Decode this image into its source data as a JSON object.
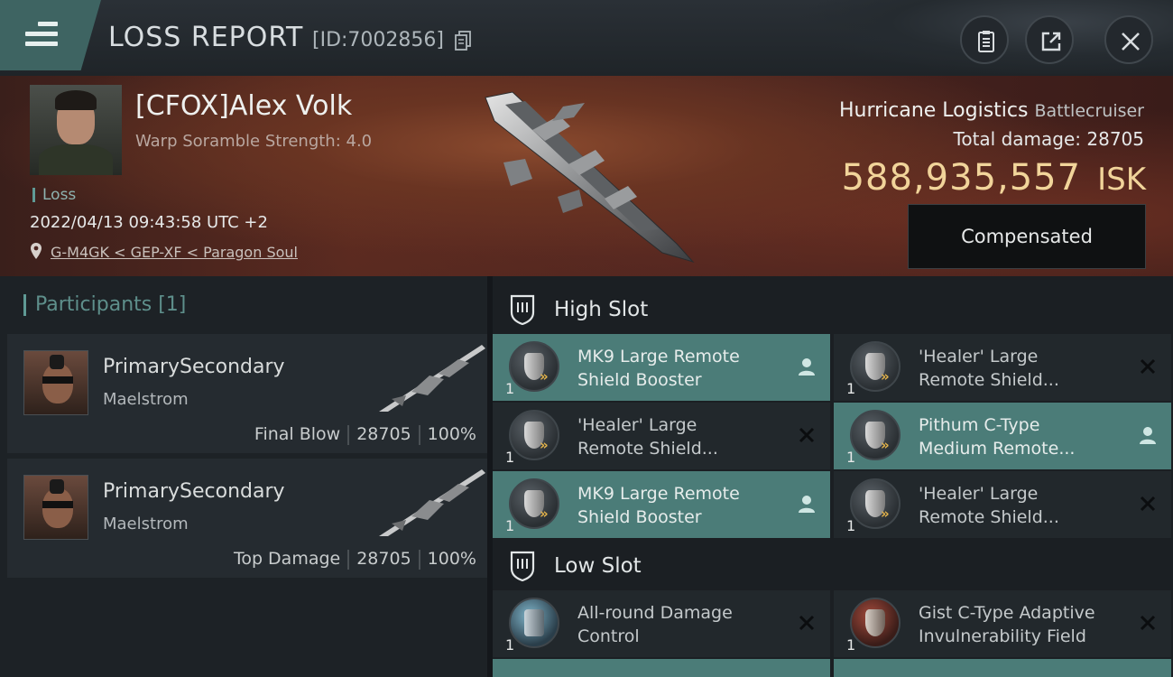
{
  "header": {
    "title": "LOSS REPORT",
    "report_id": "[ID:7002856]"
  },
  "victim": {
    "name": "[CFOX]Alex Volk",
    "scramble": "Warp Soramble Strength: 4.0",
    "tag": "Loss",
    "time": "2022/04/13 09:43:58 UTC +2",
    "location": "G-M4GK < GEP-XF < Paragon Soul",
    "ship_name": "Hurricane Logistics",
    "ship_class": "Battlecruiser",
    "damage_label": "Total damage:",
    "damage_value": "28705",
    "isk_value": "588,935,557",
    "isk_unit": "ISK",
    "compensated_label": "Compensated"
  },
  "participants": {
    "heading": "Participants [1]",
    "items": [
      {
        "name": "PrimarySecondary",
        "ship": "Maelstrom",
        "role": "Final Blow",
        "damage": "28705",
        "percent": "100%"
      },
      {
        "name": "PrimarySecondary",
        "ship": "Maelstrom",
        "role": "Top Damage",
        "damage": "28705",
        "percent": "100%"
      }
    ]
  },
  "slots": {
    "high": {
      "label": "High Slot",
      "modules": [
        {
          "line1": "MK9 Large Remote",
          "line2": "Shield Booster",
          "qty": "1",
          "status": "person"
        },
        {
          "line1": "'Healer' Large",
          "line2": "Remote Shield...",
          "qty": "1",
          "status": "x"
        },
        {
          "line1": "'Healer' Large",
          "line2": "Remote Shield...",
          "qty": "1",
          "status": "x"
        },
        {
          "line1": "Pithum C-Type",
          "line2": "Medium Remote...",
          "qty": "1",
          "status": "person"
        },
        {
          "line1": "MK9 Large Remote",
          "line2": "Shield Booster",
          "qty": "1",
          "status": "person"
        },
        {
          "line1": "'Healer' Large",
          "line2": "Remote Shield...",
          "qty": "1",
          "status": "x"
        }
      ]
    },
    "low": {
      "label": "Low Slot",
      "modules": [
        {
          "line1": "All-round Damage",
          "line2": "Control",
          "qty": "1",
          "status": "x"
        },
        {
          "line1": "Gist C-Type Adaptive",
          "line2": "Invulnerability Field",
          "qty": "1",
          "status": "x"
        }
      ]
    }
  },
  "colors": {
    "accent": "#4b7c78",
    "isk": "#f1d49a"
  }
}
